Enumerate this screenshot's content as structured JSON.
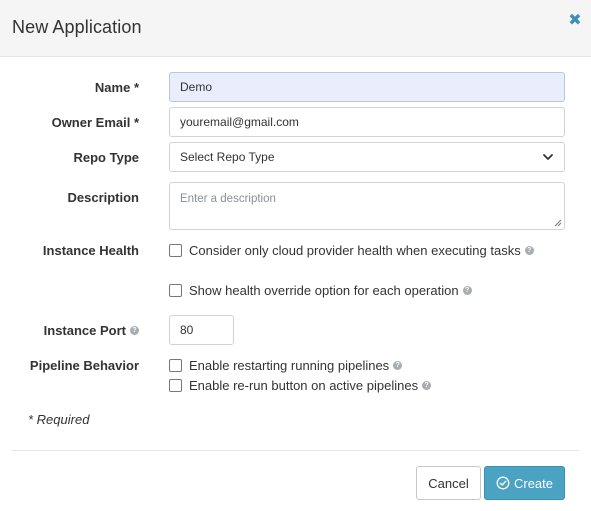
{
  "dialog": {
    "title": "New Application",
    "close_icon": "close-icon",
    "accent_color": "#3e8fb7"
  },
  "form": {
    "name": {
      "label": "Name *",
      "value": "Demo"
    },
    "owner_email": {
      "label": "Owner Email *",
      "value": "youremail@gmail.com"
    },
    "repo_type": {
      "label": "Repo Type",
      "selected": "Select Repo Type"
    },
    "description": {
      "label": "Description",
      "placeholder": "Enter a description"
    },
    "instance_health": {
      "label": "Instance Health",
      "options": [
        {
          "label": "Consider only cloud provider health when executing tasks",
          "checked": false
        },
        {
          "label": "Show health override option for each operation",
          "checked": false
        }
      ]
    },
    "instance_port": {
      "label": "Instance Port",
      "value": "80"
    },
    "pipeline_behavior": {
      "label": "Pipeline Behavior",
      "options": [
        {
          "label": "Enable restarting running pipelines",
          "checked": false
        },
        {
          "label": "Enable re-run button on active pipelines",
          "checked": false
        }
      ]
    },
    "required_note": "* Required"
  },
  "footer": {
    "cancel_label": "Cancel",
    "create_label": "Create",
    "create_color": "#4aa3c2"
  }
}
